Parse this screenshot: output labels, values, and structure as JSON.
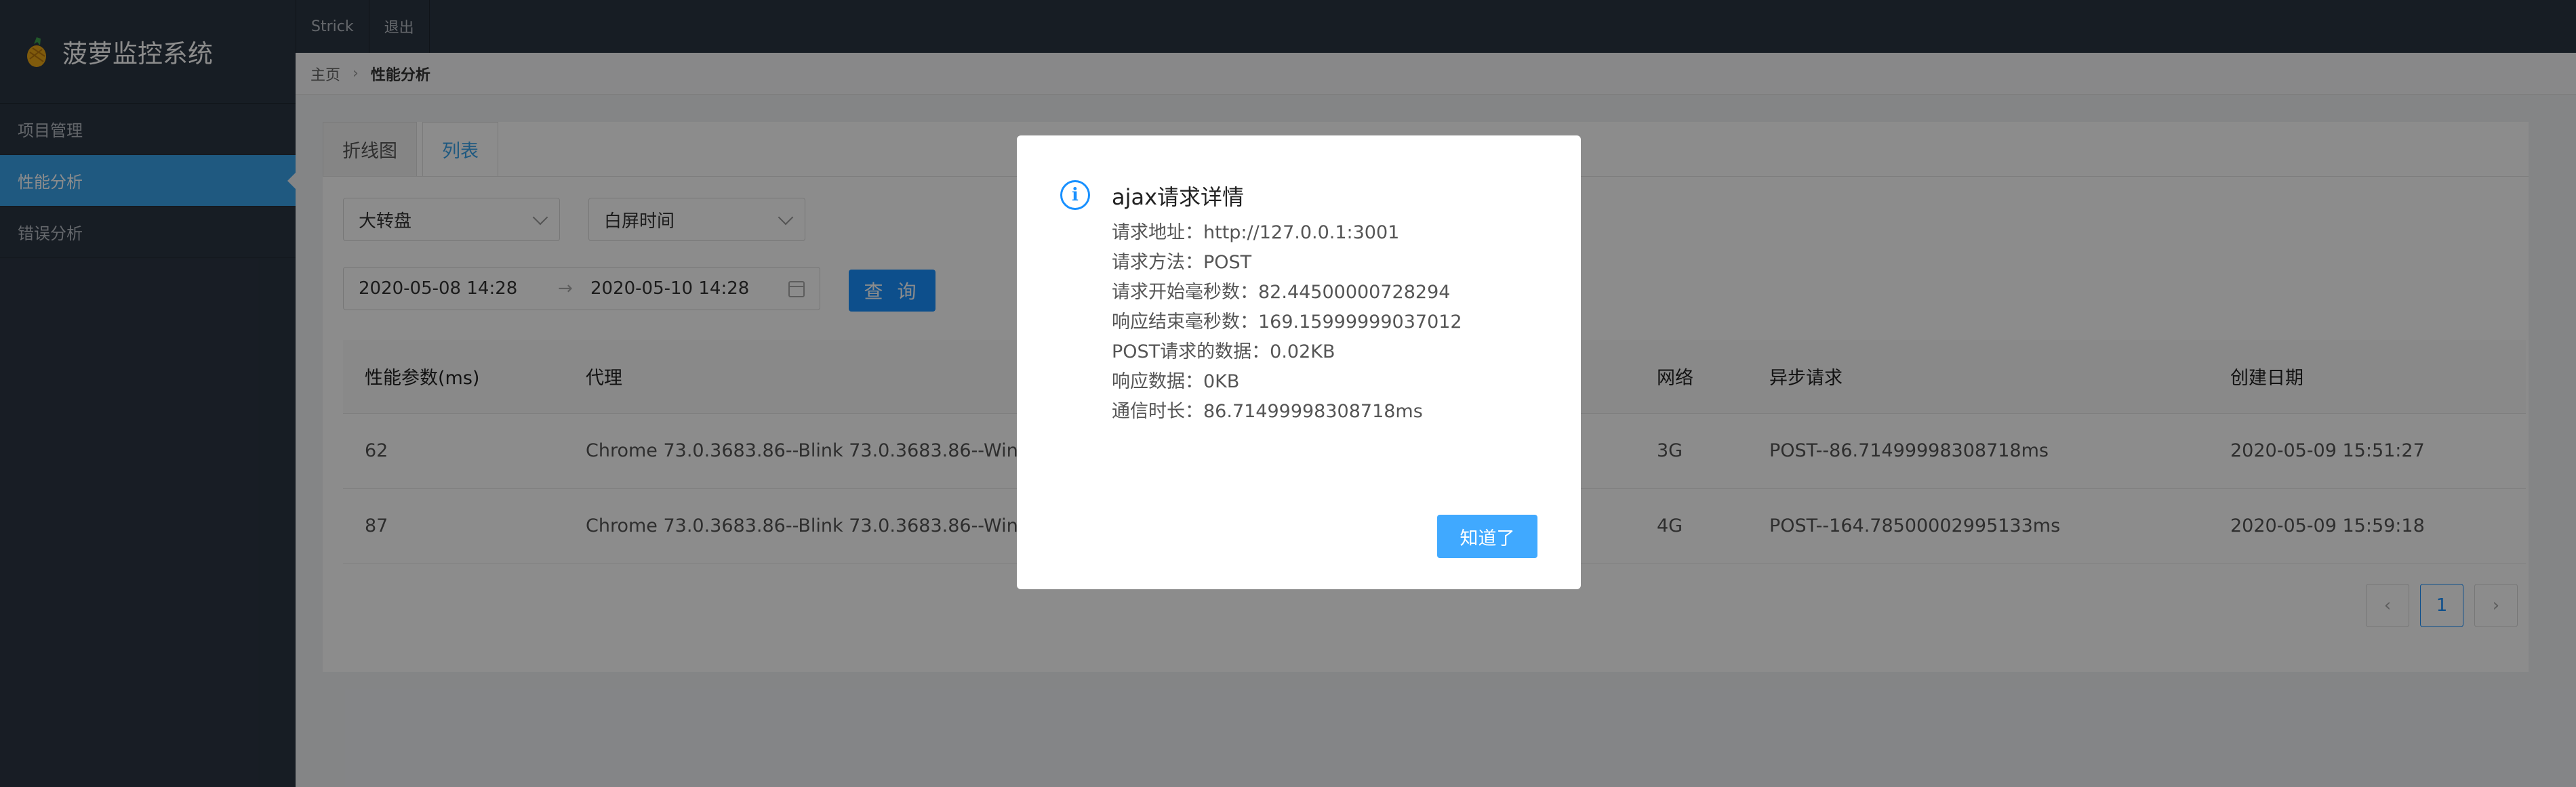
{
  "app": {
    "title": "菠萝监控系统"
  },
  "sidebar": {
    "items": [
      {
        "label": "项目管理",
        "active": false
      },
      {
        "label": "性能分析",
        "active": true
      },
      {
        "label": "错误分析",
        "active": false
      }
    ]
  },
  "topbar": {
    "user": "Strick",
    "logout": "退出"
  },
  "breadcrumb": {
    "home": "主页",
    "current": "性能分析"
  },
  "tabs": [
    {
      "label": "折线图"
    },
    {
      "label": "列表",
      "active": true
    }
  ],
  "filters": {
    "project_select": "大转盘",
    "metric_select": "白屏时间",
    "date_start": "2020-05-08 14:28",
    "date_end": "2020-05-10 14:28",
    "arrow": "→",
    "query_label": "查 询"
  },
  "table": {
    "columns": [
      "性能参数(ms)",
      "代理",
      "网络",
      "异步请求",
      "创建日期"
    ],
    "rows": [
      [
        "62",
        "Chrome 73.0.3683.86--Blink 73.0.3683.86--Wind",
        "3G",
        "POST--86.71499998308718ms",
        "2020-05-09 15:51:27"
      ],
      [
        "87",
        "Chrome 73.0.3683.86--Blink 73.0.3683.86--Wind",
        "4G",
        "POST--164.78500002995133ms",
        "2020-05-09 15:59:18"
      ]
    ]
  },
  "pagination": {
    "prev": "‹",
    "current": "1",
    "next": "›"
  },
  "modal": {
    "icon": "i",
    "title": "ajax请求详情",
    "lines": [
      "请求地址：http://127.0.0.1:3001",
      "请求方法：POST",
      "请求开始毫秒数：82.44500000728294",
      "响应结束毫秒数：169.15999999037012",
      "POST请求的数据：0.02KB",
      "响应数据：0KB",
      "通信时长：86.71499998308718ms"
    ],
    "ok_label": "知道了"
  },
  "colors": {
    "sidebar_bg": "#2b3543",
    "accent": "#1890ff",
    "menu_active": "#3aa3ea"
  }
}
